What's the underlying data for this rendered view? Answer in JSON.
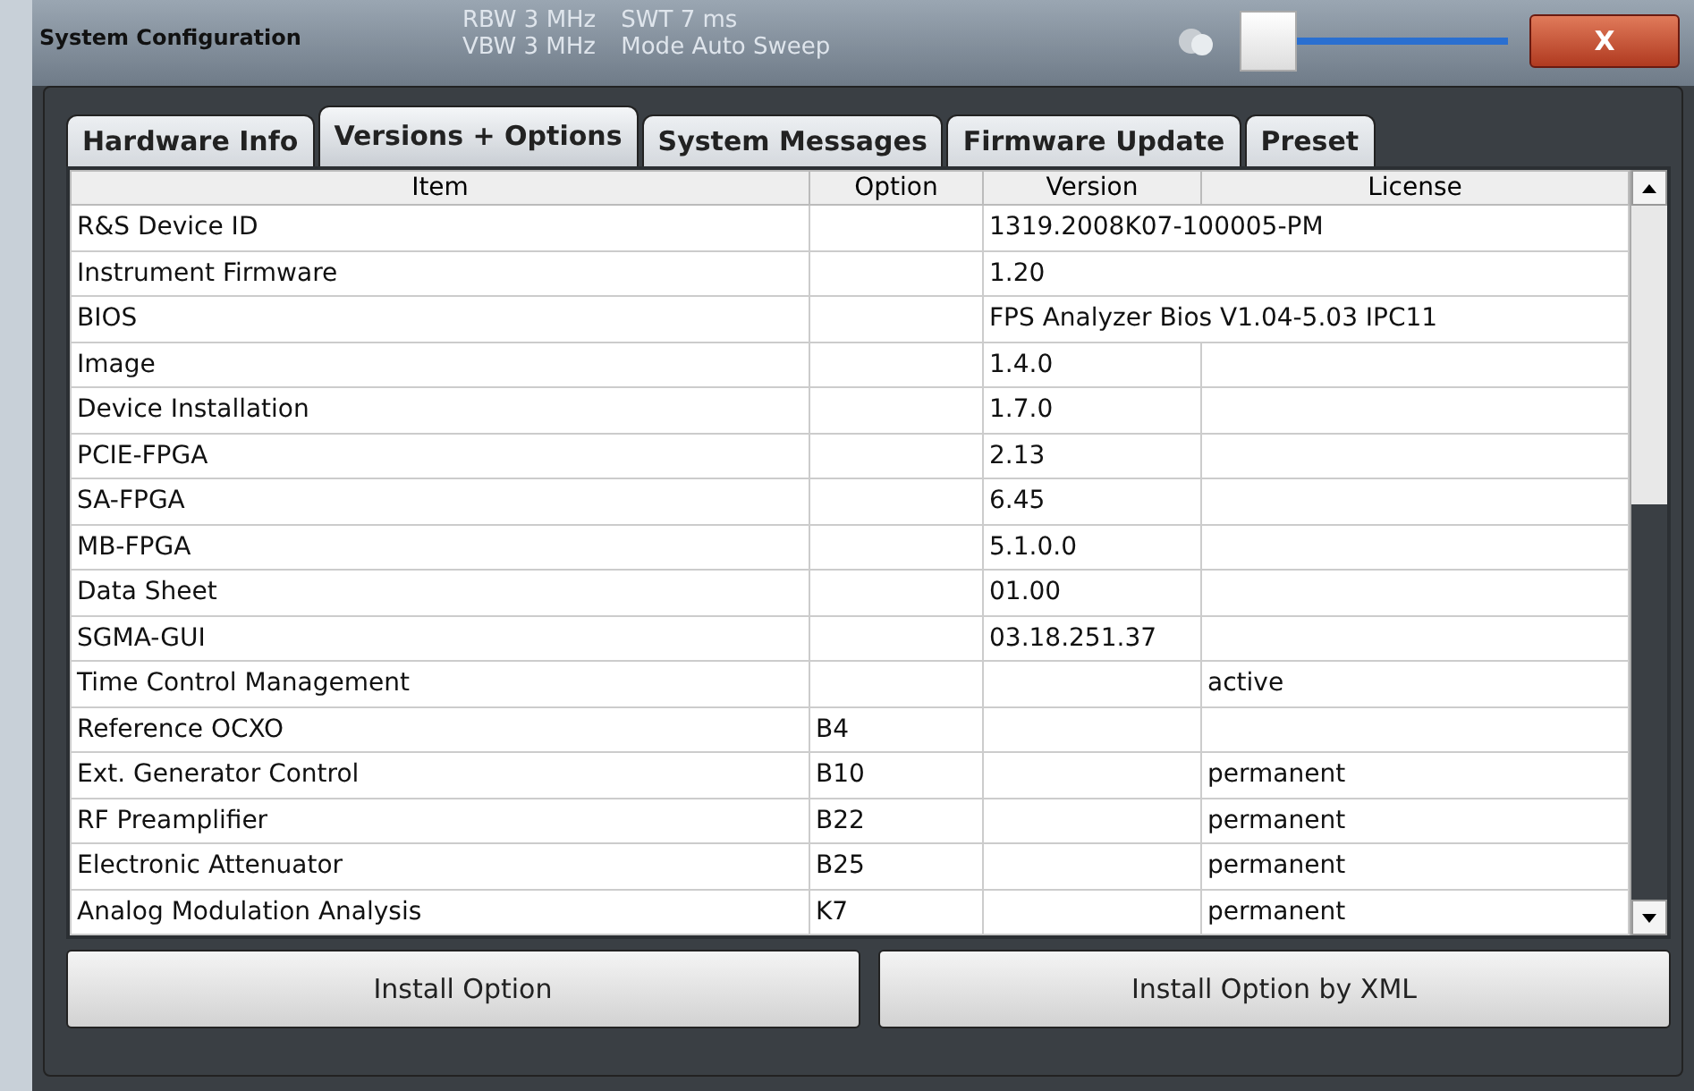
{
  "window": {
    "title": "System Configuration",
    "close": "X"
  },
  "background_readouts": [
    {
      "label": "RBW",
      "value": "3 MHz"
    },
    {
      "label": "SWT",
      "value": "7 ms"
    },
    {
      "label": "VBW",
      "value": "3 MHz"
    },
    {
      "label": "Mode",
      "value": "Auto Sweep"
    }
  ],
  "transparency_slider": {
    "level": 0
  },
  "tabs": [
    {
      "label": "Hardware Info",
      "selected": false
    },
    {
      "label": "Versions + Options",
      "selected": true
    },
    {
      "label": "System Messages",
      "selected": false
    },
    {
      "label": "Firmware Update",
      "selected": false
    },
    {
      "label": "Preset",
      "selected": false
    }
  ],
  "table": {
    "columns": [
      "Item",
      "Option",
      "Version",
      "License"
    ],
    "rows": [
      {
        "item": "R&S Device ID",
        "option": "",
        "version": "1319.2008K07-100005-PM",
        "license": "",
        "span": true
      },
      {
        "item": "Instrument Firmware",
        "option": "",
        "version": "1.20",
        "license": "",
        "span": true
      },
      {
        "item": "BIOS",
        "option": "",
        "version": "FPS Analyzer Bios V1.04-5.03 IPC11",
        "license": "",
        "span": true
      },
      {
        "item": "Image",
        "option": "",
        "version": "1.4.0",
        "license": "",
        "span": false
      },
      {
        "item": "Device Installation",
        "option": "",
        "version": "1.7.0",
        "license": "",
        "span": false
      },
      {
        "item": "PCIE-FPGA",
        "option": "",
        "version": "2.13",
        "license": "",
        "span": false
      },
      {
        "item": "SA-FPGA",
        "option": "",
        "version": "6.45",
        "license": "",
        "span": false
      },
      {
        "item": "MB-FPGA",
        "option": "",
        "version": "5.1.0.0",
        "license": "",
        "span": false
      },
      {
        "item": "Data Sheet",
        "option": "",
        "version": "01.00",
        "license": "",
        "span": false
      },
      {
        "item": "SGMA-GUI",
        "option": "",
        "version": "03.18.251.37",
        "license": "",
        "span": false
      },
      {
        "item": "Time Control Management",
        "option": "",
        "version": "",
        "license": "active",
        "span": false
      },
      {
        "item": "Reference OCXO",
        "option": "B4",
        "version": "",
        "license": "",
        "span": false
      },
      {
        "item": "Ext. Generator Control",
        "option": "B10",
        "version": "",
        "license": "permanent",
        "span": false
      },
      {
        "item": "RF Preamplifier",
        "option": "B22",
        "version": "",
        "license": "permanent",
        "span": false
      },
      {
        "item": "Electronic Attenuator",
        "option": "B25",
        "version": "",
        "license": "permanent",
        "span": false
      },
      {
        "item": "Analog Modulation Analysis",
        "option": "K7",
        "version": "",
        "license": "permanent",
        "span": false
      }
    ]
  },
  "buttons": [
    "Install Option",
    "Install Option by XML"
  ]
}
